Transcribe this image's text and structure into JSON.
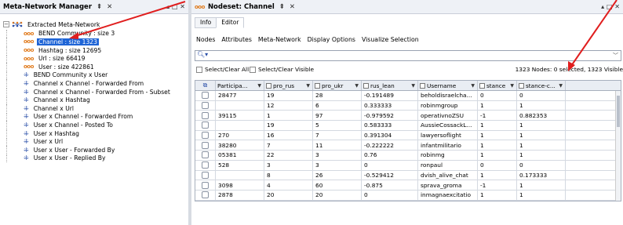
{
  "left_panel": {
    "title": "Meta-Network Manager",
    "pin": "⇞",
    "close": "✕",
    "window_controls": "▴ □ ✕",
    "root_label": "Extracted Meta-Network",
    "items": [
      {
        "icon": "dots",
        "label": "BEND Community : size 3",
        "selected": false
      },
      {
        "icon": "dots",
        "label": "Channel : size 1323",
        "selected": true
      },
      {
        "icon": "dots",
        "label": "Hashtag : size 12695",
        "selected": false
      },
      {
        "icon": "dots",
        "label": "Url : size 66419",
        "selected": false
      },
      {
        "icon": "dots",
        "label": "User : size 422861",
        "selected": false
      },
      {
        "icon": "graph",
        "label": "BEND Community x User",
        "selected": false
      },
      {
        "icon": "graph",
        "label": "Channel x Channel - Forwarded From",
        "selected": false
      },
      {
        "icon": "graph",
        "label": "Channel x Channel - Forwarded From - Subset",
        "selected": false
      },
      {
        "icon": "graph",
        "label": "Channel x Hashtag",
        "selected": false
      },
      {
        "icon": "graph",
        "label": "Channel x Url",
        "selected": false
      },
      {
        "icon": "graph",
        "label": "User x Channel - Forwarded From",
        "selected": false
      },
      {
        "icon": "graph",
        "label": "User x Channel - Posted To",
        "selected": false
      },
      {
        "icon": "graph",
        "label": "User x Hashtag",
        "selected": false
      },
      {
        "icon": "graph",
        "label": "User x Url",
        "selected": false
      },
      {
        "icon": "graph",
        "label": "User x User - Forwarded By",
        "selected": false
      },
      {
        "icon": "graph",
        "label": "User x User - Replied By",
        "selected": false
      }
    ]
  },
  "right_panel": {
    "title_prefix": "ooo",
    "title": "Nodeset: Channel",
    "pin": "⇞",
    "close": "✕",
    "window_controls": "▴ □ ✕",
    "tabs": [
      "Info",
      "Editor"
    ],
    "active_tab": "Editor",
    "menu": [
      "Nodes",
      "Attributes",
      "Meta-Network",
      "Display Options",
      "Visualize Selection"
    ],
    "search": {
      "value": "",
      "placeholder": ""
    },
    "select_clear_all": "Select/Clear All",
    "select_clear_visible": "Select/Clear Visible",
    "status": "1323 Nodes: 0 selected, 1323 Visible",
    "columns": [
      "Participa...",
      "pro_rus",
      "pro_ukr",
      "rus_lean",
      "Username",
      "stance",
      "stance-c..."
    ],
    "rows": [
      [
        "28477",
        "19",
        "28",
        "-0.191489",
        "beholdisraelcha...",
        "0",
        "0"
      ],
      [
        "",
        "12",
        "6",
        "0.333333",
        "robinmgroup",
        "1",
        "1"
      ],
      [
        "39115",
        "1",
        "97",
        "-0.979592",
        "operativnoZSU",
        "-1",
        "0.882353"
      ],
      [
        "",
        "19",
        "5",
        "0.583333",
        "AussieCossackL...",
        "1",
        "1"
      ],
      [
        "270",
        "16",
        "7",
        "0.391304",
        "lawyersoflight",
        "1",
        "1"
      ],
      [
        "38280",
        "7",
        "11",
        "-0.222222",
        "infantmilitario",
        "1",
        "1"
      ],
      [
        "05381",
        "22",
        "3",
        "0.76",
        "robinmg",
        "1",
        "1"
      ],
      [
        "528",
        "3",
        "3",
        "0",
        "ronpaul",
        "0",
        "0"
      ],
      [
        "",
        "8",
        "26",
        "-0.529412",
        "dvish_alive_chat",
        "1",
        "0.173333"
      ],
      [
        "3098",
        "4",
        "60",
        "-0.875",
        "sprava_groma",
        "-1",
        "1"
      ],
      [
        "2878",
        "20",
        "20",
        "0",
        "inmagnaexcitatio",
        "1",
        "1"
      ]
    ]
  },
  "colors": {
    "selection": "#1e64d6",
    "annotation_arrow": "#e01e1e",
    "nodeset_icon": "#e07a1b",
    "graph_icon": "#2a4fa8"
  }
}
